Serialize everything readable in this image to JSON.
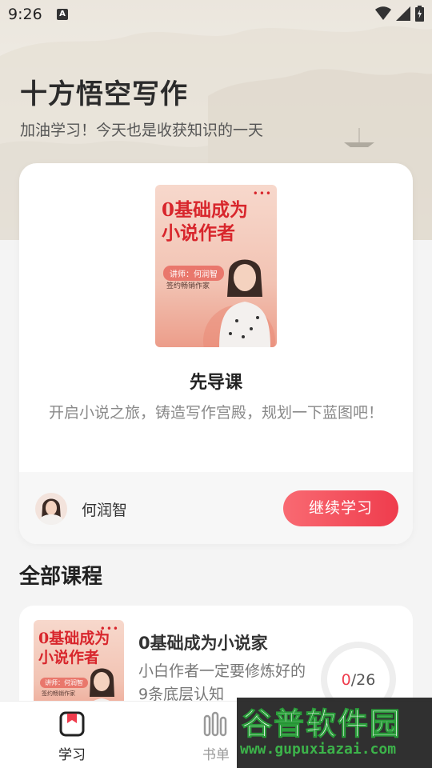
{
  "status_bar": {
    "time": "9:26",
    "indicator": "A"
  },
  "header": {
    "title": "十方悟空写作",
    "subtitle": "加油学习！今天也是收获知识的一天"
  },
  "featured": {
    "cover": {
      "title_line1": "0基础成为",
      "title_line2": "小说作者",
      "tag": "讲师：何润智",
      "role": "签约畅销作家",
      "dots": "•••"
    },
    "course_name": "先导课",
    "description": "开启小说之旅，铸造写作宫殿，规划一下蓝图吧！",
    "teacher_name": "何润智",
    "continue_label": "继续学习"
  },
  "section": {
    "title": "全部课程"
  },
  "courses": [
    {
      "cover": {
        "title_line1": "0基础成为",
        "title_line2": "小说作者",
        "tag": "讲师：何润智",
        "role": "签约畅销作家",
        "dots": "•••"
      },
      "title": "0基础成为小说家",
      "description": "小白作者一定要修炼好的9条底层认知",
      "progress_done": "0",
      "progress_sep": "/",
      "progress_total": "26",
      "progress_fraction": 0
    }
  ],
  "nav": {
    "items": [
      {
        "label": "学习",
        "icon": "bookmark-book-icon",
        "active": true
      },
      {
        "label": "书单",
        "icon": "bookshelf-icon",
        "active": false
      }
    ]
  },
  "watermark": {
    "logo": "谷普软件园",
    "url": "www.gupuxiazai.com"
  },
  "colors": {
    "accent": "#ef3c4d",
    "cover_red": "#d8262c",
    "cover_bg": "#f2c3b3"
  }
}
